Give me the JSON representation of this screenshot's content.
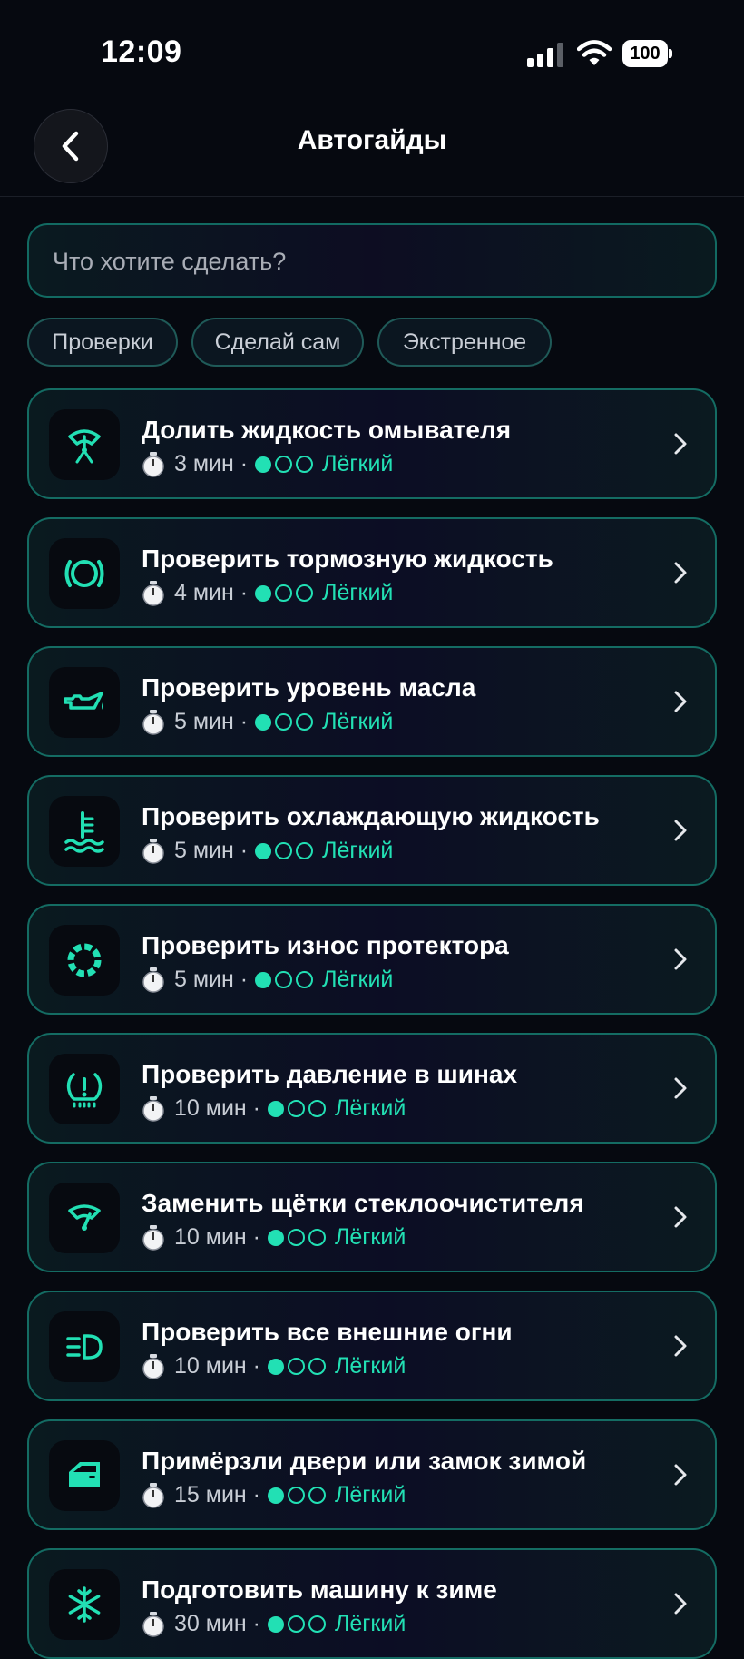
{
  "status": {
    "time": "12:09",
    "battery": "100"
  },
  "header": {
    "title": "Автогайды"
  },
  "search": {
    "placeholder": "Что хотите сделать?"
  },
  "chips": [
    "Проверки",
    "Сделай сам",
    "Экстренное"
  ],
  "guides": [
    {
      "title": "Долить жидкость омывателя",
      "time": "3 мин",
      "level": "Лёгкий",
      "icon": "washer-fluid-icon"
    },
    {
      "title": "Проверить тормозную жидкость",
      "time": "4 мин",
      "level": "Лёгкий",
      "icon": "brake-warning-icon"
    },
    {
      "title": "Проверить уровень масла",
      "time": "5 мин",
      "level": "Лёгкий",
      "icon": "oil-can-icon"
    },
    {
      "title": "Проверить охлаждающую жидкость",
      "time": "5 мин",
      "level": "Лёгкий",
      "icon": "coolant-temperature-icon"
    },
    {
      "title": "Проверить износ протектора",
      "time": "5 мин",
      "level": "Лёгкий",
      "icon": "tire-tread-icon"
    },
    {
      "title": "Проверить давление в шинах",
      "time": "10 мин",
      "level": "Лёгкий",
      "icon": "tire-pressure-icon"
    },
    {
      "title": "Заменить щётки стеклоочистителя",
      "time": "10 мин",
      "level": "Лёгкий",
      "icon": "wiper-icon"
    },
    {
      "title": "Проверить все внешние огни",
      "time": "10 мин",
      "level": "Лёгкий",
      "icon": "headlight-icon"
    },
    {
      "title": "Примёрзли двери или замок зимой",
      "time": "15 мин",
      "level": "Лёгкий",
      "icon": "car-door-icon"
    },
    {
      "title": "Подготовить машину к зиме",
      "time": "30 мин",
      "level": "Лёгкий",
      "icon": "snowflake-icon"
    }
  ],
  "colors": {
    "accent": "#22e0b4",
    "background": "#060910",
    "card_border": "#146c63"
  }
}
